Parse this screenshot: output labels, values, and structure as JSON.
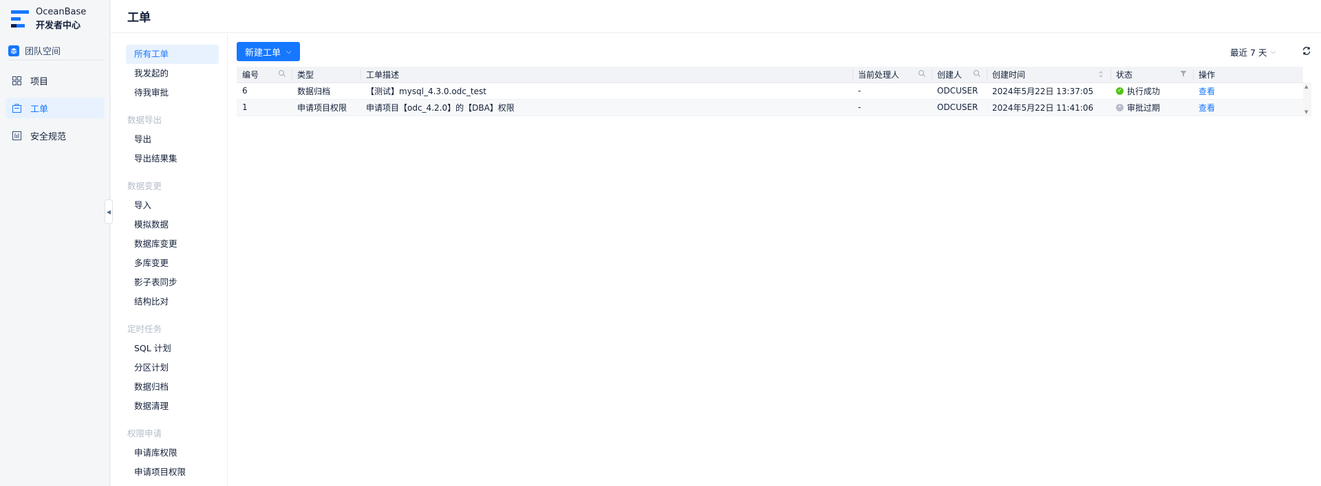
{
  "brand": {
    "name_line1": "OceanBase",
    "name_line2": "开发者中心",
    "color": "#1677ff"
  },
  "team": {
    "label": "团队空间",
    "icon": "layers-icon"
  },
  "rail": {
    "items": [
      {
        "label": "项目",
        "icon": "project-grid-icon",
        "active": false
      },
      {
        "label": "工单",
        "icon": "ticket-icon",
        "active": true
      },
      {
        "label": "安全规范",
        "icon": "shield-rules-icon",
        "active": false
      }
    ]
  },
  "page": {
    "title": "工单"
  },
  "subnav": {
    "top": [
      "所有工单",
      "我发起的",
      "待我审批"
    ],
    "groups": [
      {
        "title": "数据导出",
        "items": [
          "导出",
          "导出结果集"
        ]
      },
      {
        "title": "数据变更",
        "items": [
          "导入",
          "模拟数据",
          "数据库变更",
          "多库变更",
          "影子表同步",
          "结构比对"
        ]
      },
      {
        "title": "定时任务",
        "items": [
          "SQL 计划",
          "分区计划",
          "数据归档",
          "数据清理"
        ]
      },
      {
        "title": "权限申请",
        "items": [
          "申请库权限",
          "申请项目权限"
        ]
      }
    ]
  },
  "toolbar": {
    "new_label": "新建工单",
    "time_filter": "最近 7 天"
  },
  "table": {
    "columns": [
      "编号",
      "类型",
      "工单描述",
      "当前处理人",
      "创建人",
      "创建时间",
      "状态",
      "操作"
    ],
    "rows": [
      {
        "id": "6",
        "type": "数据归档",
        "desc": "【测试】mysql_4.3.0.odc_test",
        "handler": "-",
        "creator": "ODCUSER",
        "created": "2024年5月22日 13:37:05",
        "status": "执行成功",
        "status_color": "#52c41a",
        "action": "查看"
      },
      {
        "id": "1",
        "type": "申请项目权限",
        "desc": "申请项目【odc_4.2.0】的【DBA】权限",
        "handler": "-",
        "creator": "ODCUSER",
        "created": "2024年5月22日 11:41:06",
        "status": "审批过期",
        "status_color": "#b8bec9",
        "action": "查看"
      }
    ]
  }
}
